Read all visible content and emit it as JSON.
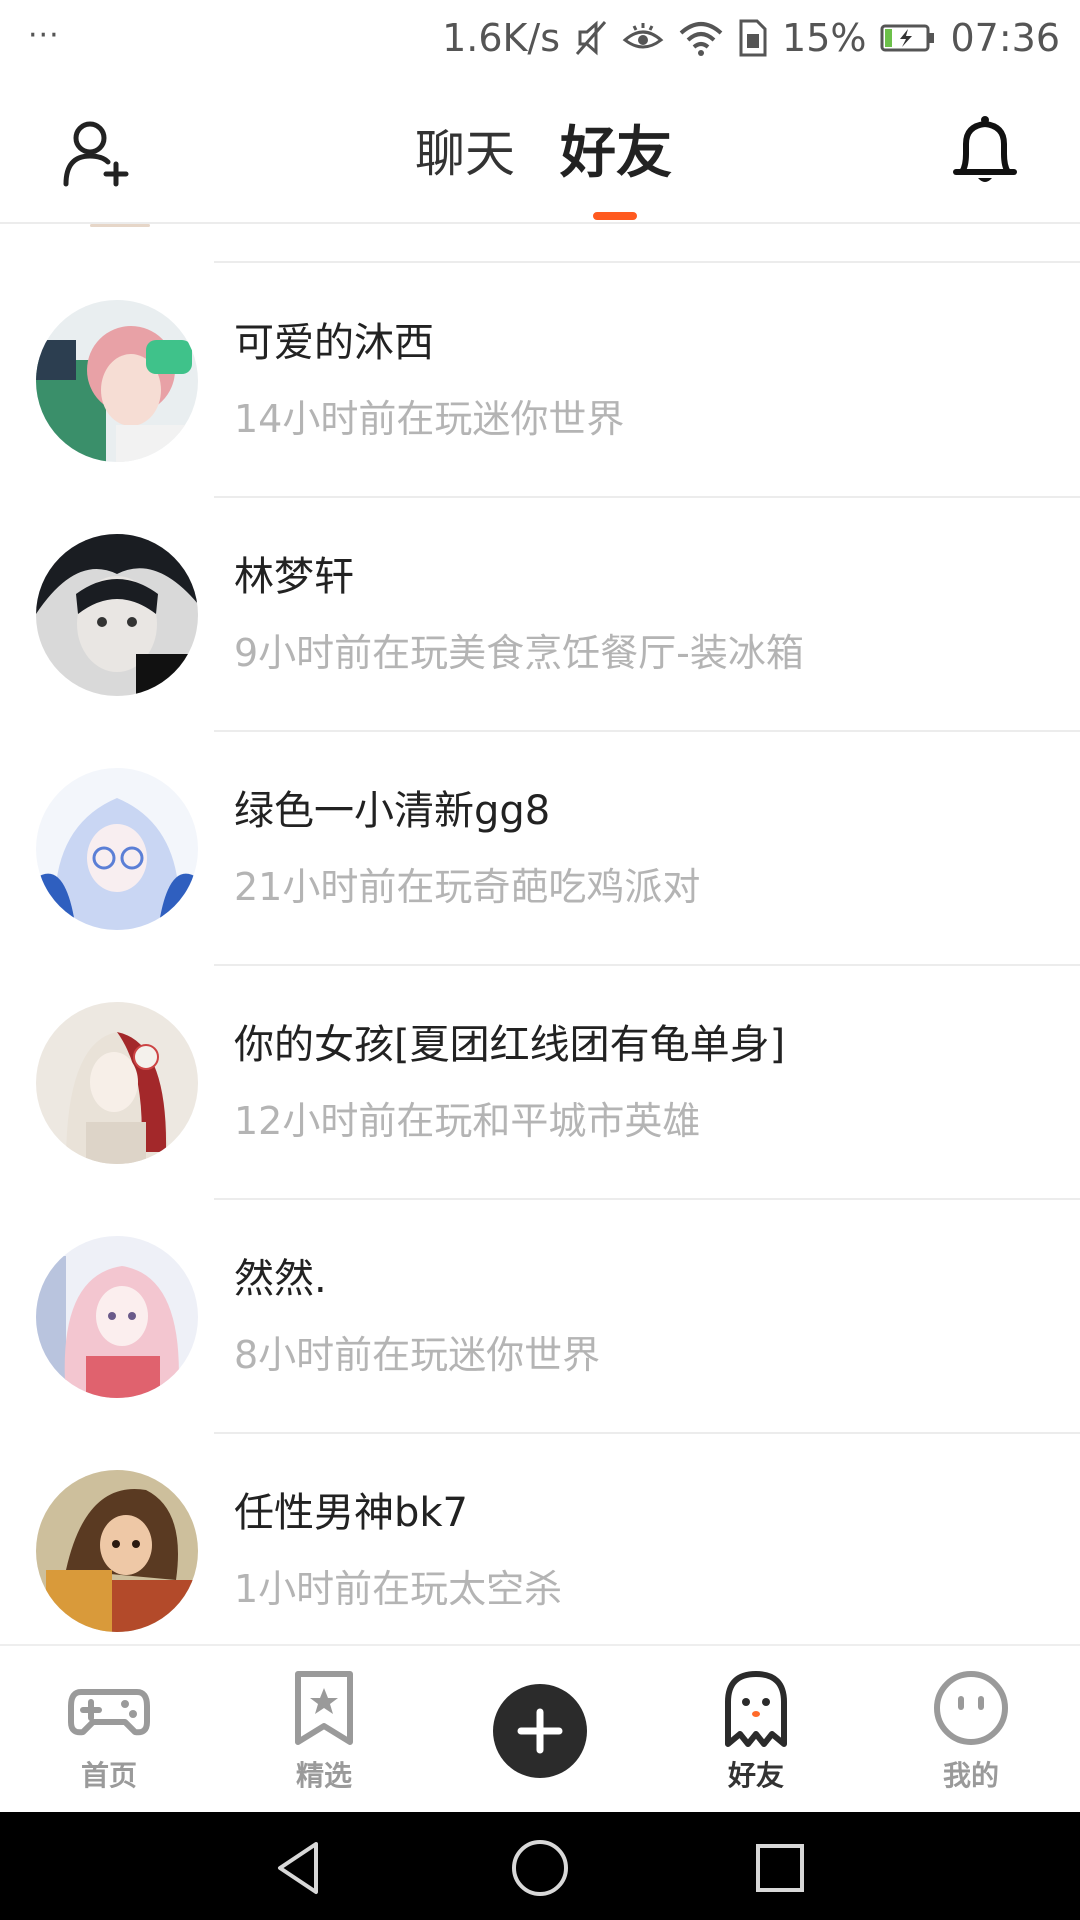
{
  "status_bar": {
    "dots": "···",
    "net_speed": "1.6K/s",
    "battery_percent": "15%",
    "time": "07:36"
  },
  "header": {
    "tabs": [
      {
        "label": "聊天",
        "active": false
      },
      {
        "label": "好友",
        "active": true
      }
    ],
    "accent_color": "#ff5a1f"
  },
  "friends": [
    {
      "name": "可爱的沐西",
      "status": "14小时前在玩迷你世界"
    },
    {
      "name": "林梦轩",
      "status": "9小时前在玩美食烹饪餐厅-装冰箱"
    },
    {
      "name": "绿色一小清新gg8",
      "status": "21小时前在玩奇葩吃鸡派对"
    },
    {
      "name": "你的女孩[夏团红线团有龟单身]",
      "status": "12小时前在玩和平城市英雄"
    },
    {
      "name": "然然.",
      "status": "8小时前在玩迷你世界"
    },
    {
      "name": "任性男神bk7",
      "status": "1小时前在玩太空杀"
    }
  ],
  "bottom_nav": {
    "items": [
      {
        "label": "首页",
        "icon": "gamepad-icon"
      },
      {
        "label": "精选",
        "icon": "star-bookmark-icon"
      },
      {
        "label": "",
        "icon": "plus-icon"
      },
      {
        "label": "好友",
        "icon": "ghost-icon",
        "active": true
      },
      {
        "label": "我的",
        "icon": "face-icon"
      }
    ]
  }
}
